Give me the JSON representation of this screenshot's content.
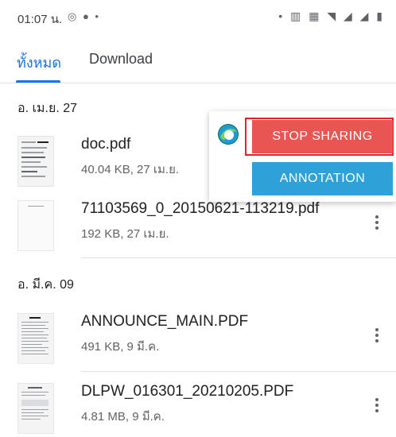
{
  "status_bar": {
    "time": "01:07 น.",
    "left_icons": "◎ ● •",
    "right_icons": "• ▥ ▦ ◥ ◢ ◢ ▮"
  },
  "tabs": [
    {
      "label": "ทั้งหมด",
      "active": true
    },
    {
      "label": "Download",
      "active": false
    }
  ],
  "sections": [
    {
      "date": "อ. เม.ย. 27",
      "files": [
        {
          "name": "doc.pdf",
          "meta": "40.04 KB, 27 เม.ย."
        },
        {
          "name": "71103569_0_20150621-113219.pdf",
          "meta": "192 KB, 27 เม.ย."
        }
      ]
    },
    {
      "date": "อ. มี.ค. 09",
      "files": [
        {
          "name": "ANNOUNCE_MAIN.PDF",
          "meta": "491 KB, 9 มี.ค."
        },
        {
          "name": "DLPW_016301_20210205.PDF",
          "meta": "4.81 MB, 9 มี.ค."
        }
      ]
    }
  ],
  "share_overlay": {
    "stop_label": "STOP SHARING",
    "annotation_label": "ANNOTATION",
    "stop_color": "#e95552",
    "annotation_color": "#2ea2d8",
    "highlight_color": "#e0232b"
  },
  "colors": {
    "accent": "#1a73e8"
  }
}
